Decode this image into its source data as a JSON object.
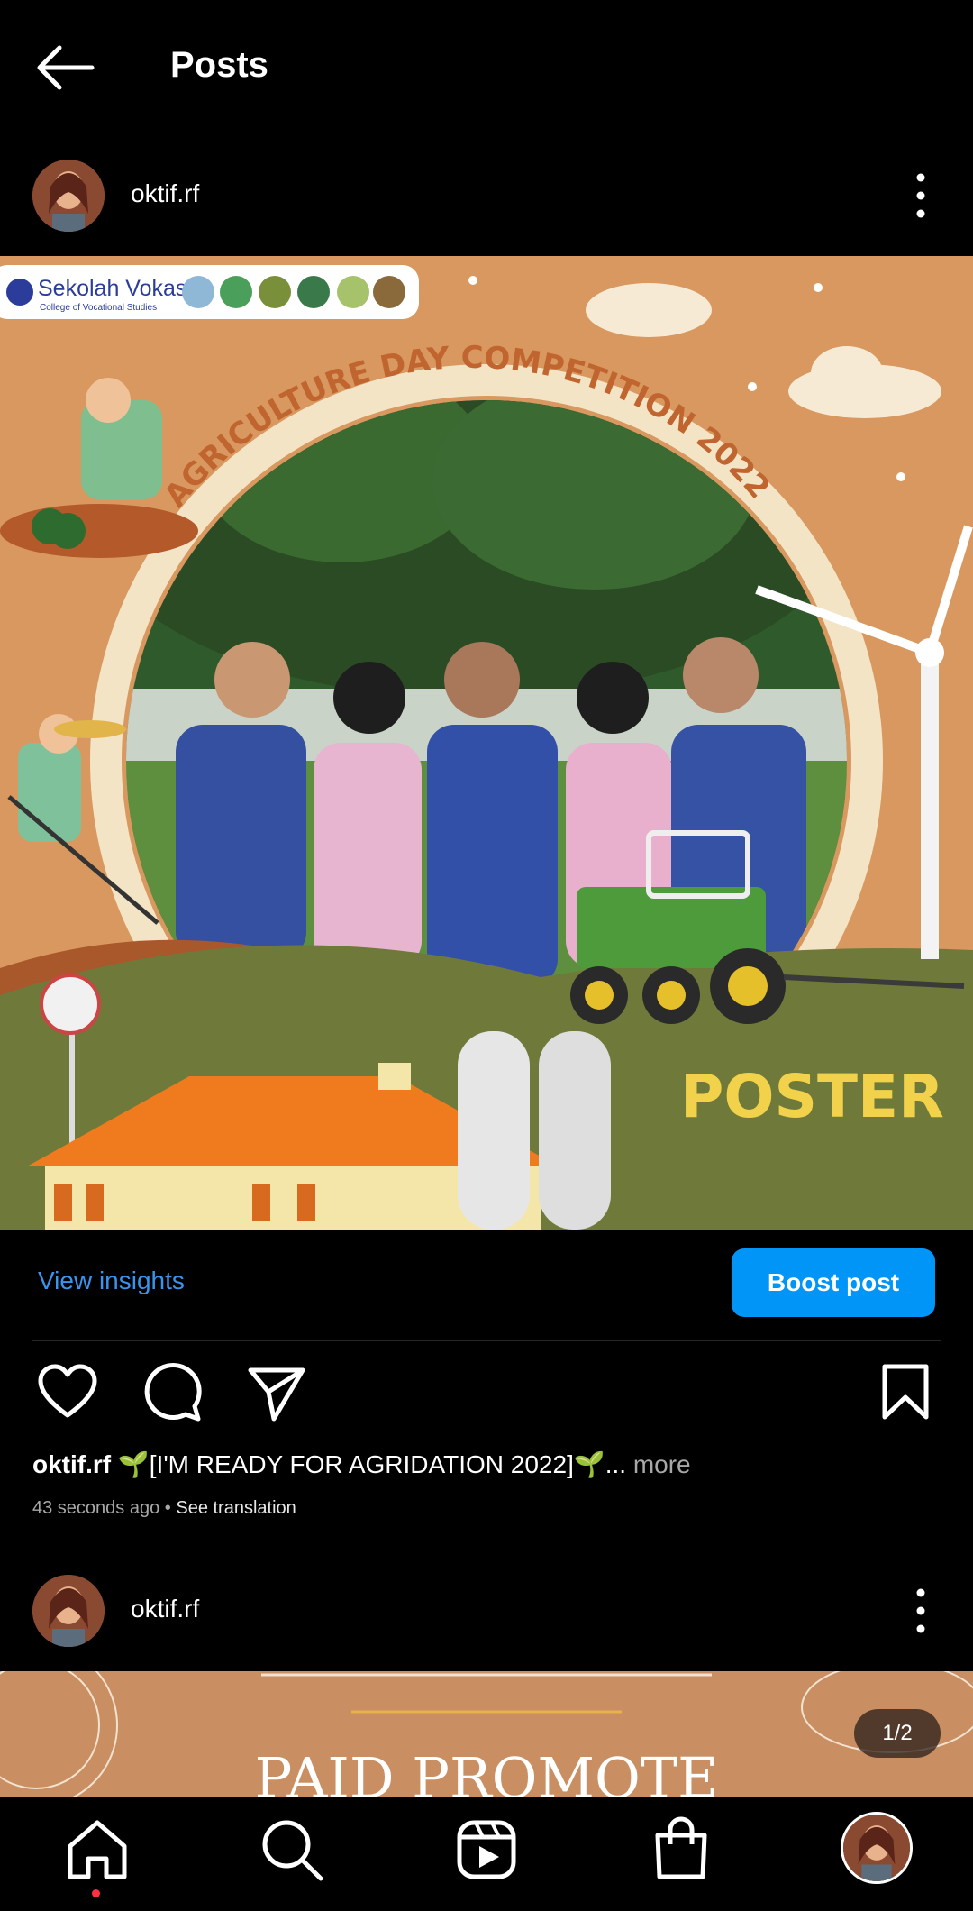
{
  "header": {
    "title": "Posts",
    "back_icon": "arrow-left-icon"
  },
  "posts": [
    {
      "username": "oktif.rf",
      "image": {
        "banner_title": "Sekolah Vokasi",
        "banner_subtitle": "College of Vocational Studies",
        "headline": "AGRICULTURE DAY COMPETITION 2022",
        "badge": "POSTER"
      },
      "insights_label": "View insights",
      "boost_label": "Boost post",
      "caption_user": "oktif.rf",
      "caption_text": "🌱[I'M READY FOR AGRIDATION 2022]🌱...",
      "caption_more": " more",
      "timestamp": "43 seconds ago",
      "separator": " • ",
      "see_translation": "See translation"
    },
    {
      "username": "oktif.rf",
      "image": {
        "headline": "PAID PROMOTE"
      },
      "counter": "1/2"
    }
  ],
  "actions": [
    "heart-icon",
    "comment-icon",
    "share-icon",
    "bookmark-icon"
  ],
  "nav": [
    "home-icon",
    "search-icon",
    "reels-icon",
    "shop-icon",
    "profile-avatar"
  ],
  "colors": {
    "accent": "#0095f6",
    "link": "#3b93ec",
    "background": "#000000",
    "notification_dot": "#ff3040"
  }
}
